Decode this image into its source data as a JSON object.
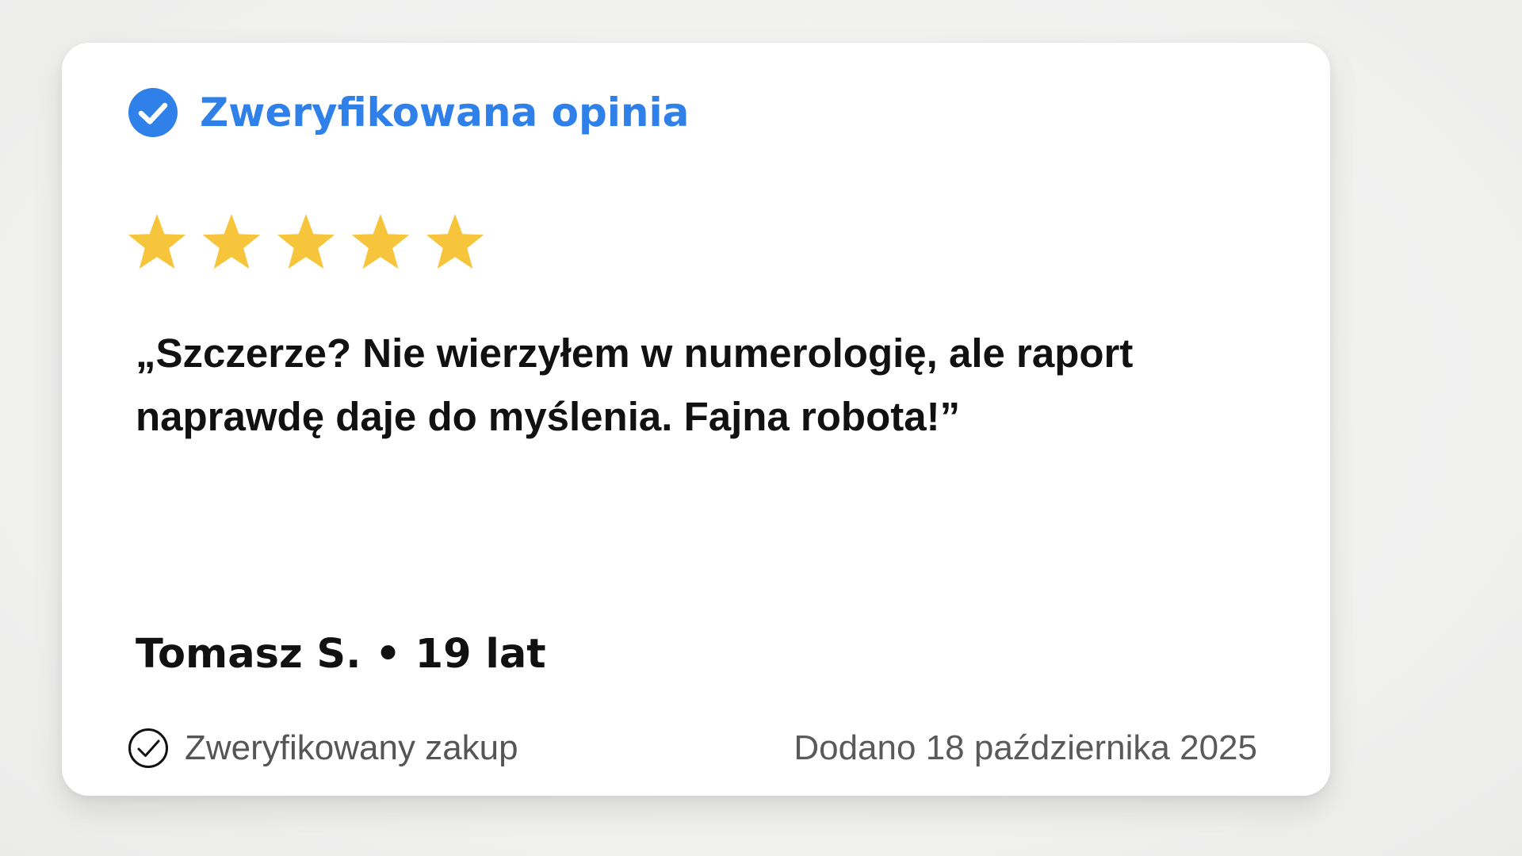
{
  "review": {
    "badge_title": "Zweryfikowana opinia",
    "rating": 5,
    "rating_max": 5,
    "text": "„Szczerze? Nie wierzyłem w numerologię, ale raport naprawdę daje do myślenia. Fajna robota!”",
    "author": "Tomasz S. • 19 lat",
    "purchase_label": "Zweryfikowany zakup",
    "date": "Dodano 18 października 2025"
  },
  "colors": {
    "accent": "#2f80e8",
    "star": "#f7c53b",
    "text": "#111111",
    "muted": "#555555",
    "card": "#ffffff",
    "background": "#f1f1f0"
  },
  "icons": {
    "badge": "verified-check-icon",
    "star": "star-icon",
    "purchase": "check-circle-outline-icon"
  }
}
